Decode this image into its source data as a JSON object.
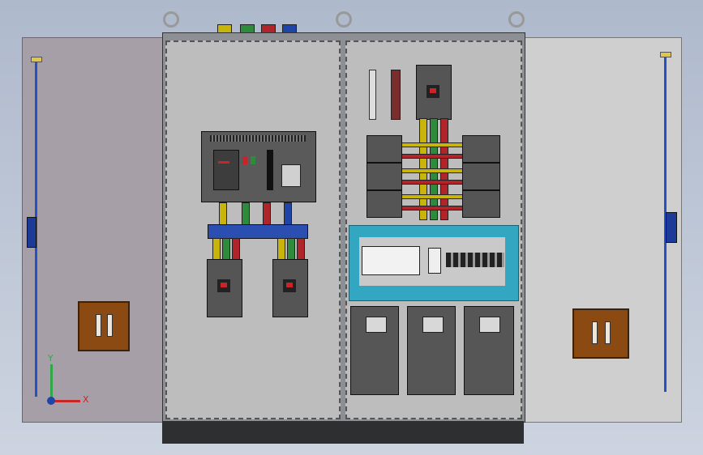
{
  "scene": "electrical-cabinet-cad-view",
  "axis": {
    "x_label": "X",
    "y_label": "Y"
  },
  "colors": {
    "phase_yellow": "#c8b40a",
    "phase_green": "#2e8b3c",
    "phase_red": "#b0252a",
    "phase_blue": "#1f45a8",
    "busbar_blue": "#2b4fb0",
    "tray_cyan": "#33a7c2",
    "door_handle": "#8a4a12",
    "rod_blue": "#2450c8"
  },
  "icons": [
    "lifting-eye-icon",
    "door-handle-icon",
    "axis-triad-icon",
    "terminal-lug-icon"
  ]
}
